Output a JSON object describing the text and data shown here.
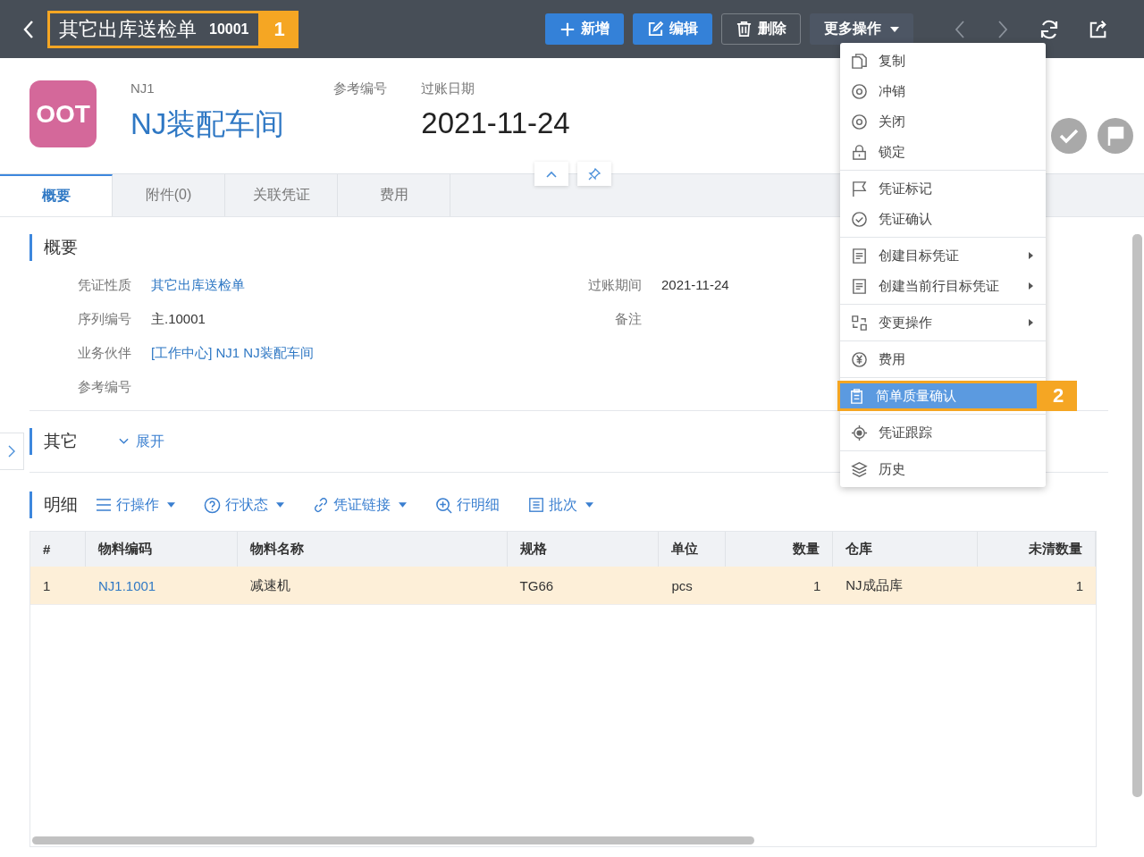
{
  "topbar": {
    "title": "其它出库送检单",
    "number": "10001",
    "callout": "1",
    "buttons": [
      {
        "label": "新增",
        "kind": "primary"
      },
      {
        "label": "编辑",
        "kind": "edit"
      },
      {
        "label": "删除",
        "kind": "delete"
      },
      {
        "label": "更多操作",
        "kind": "menu",
        "expanded": true
      }
    ]
  },
  "header": {
    "logo": "OOT",
    "code": "NJ1",
    "name": "NJ装配车间",
    "ref_label": "参考编号",
    "date_label": "过账日期",
    "date": "2021-11-24"
  },
  "tabs": [
    {
      "label": "概要",
      "selected": true
    },
    {
      "label": "附件(0)",
      "selected": false
    },
    {
      "label": "关联凭证",
      "selected": false
    },
    {
      "label": "费用",
      "selected": false
    }
  ],
  "summary": {
    "title": "概要",
    "fields": [
      {
        "label": "凭证性质",
        "value": "其它出库送检单",
        "link": true
      },
      {
        "label": "序列编号",
        "value": "主.10001",
        "link": false
      },
      {
        "label": "业务伙伴",
        "value": "[工作中心] NJ1 NJ装配车间",
        "link": true
      },
      {
        "label": "参考编号"
      }
    ],
    "right_fields": [
      {
        "label": "过账期间",
        "value": "2021-11-24"
      },
      {
        "label": "备注"
      }
    ]
  },
  "other": {
    "title": "其它",
    "toggle": "展开",
    "expanded": false
  },
  "detail": {
    "title": "明细",
    "tools": [
      {
        "label": "行操作",
        "dropdown": true
      },
      {
        "label": "行状态",
        "dropdown": true
      },
      {
        "label": "凭证链接",
        "dropdown": true
      },
      {
        "label": "行明细",
        "dropdown": false
      },
      {
        "label": "批次",
        "dropdown": true
      }
    ],
    "columns": [
      "#",
      "物料编码",
      "物料名称",
      "规格",
      "单位",
      "数量",
      "仓库",
      "未清数量"
    ],
    "rows": [
      {
        "selected": true,
        "cells": [
          "1",
          "NJ1.1001",
          "减速机",
          "TG66",
          "pcs",
          "1",
          "NJ成品库",
          "1"
        ]
      }
    ]
  },
  "menu": {
    "groups": [
      [
        {
          "label": "复制",
          "submenu": false,
          "selected": false
        },
        {
          "label": "冲销",
          "submenu": false,
          "selected": false
        },
        {
          "label": "关闭",
          "submenu": false,
          "selected": false
        },
        {
          "label": "锁定",
          "submenu": false,
          "selected": false
        }
      ],
      [
        {
          "label": "凭证标记",
          "submenu": false,
          "selected": false
        },
        {
          "label": "凭证确认",
          "submenu": false,
          "selected": false
        }
      ],
      [
        {
          "label": "创建目标凭证",
          "submenu": true,
          "selected": false
        },
        {
          "label": "创建当前行目标凭证",
          "submenu": true,
          "selected": false
        }
      ],
      [
        {
          "label": "变更操作",
          "submenu": true,
          "selected": false
        }
      ],
      [
        {
          "label": "费用",
          "submenu": false,
          "selected": false
        }
      ],
      [
        {
          "label": "简单质量确认",
          "submenu": false,
          "selected": true,
          "callout": "2"
        }
      ],
      [
        {
          "label": "凭证跟踪",
          "submenu": false,
          "selected": false
        }
      ],
      [
        {
          "label": "历史",
          "submenu": false,
          "selected": false
        }
      ]
    ]
  }
}
